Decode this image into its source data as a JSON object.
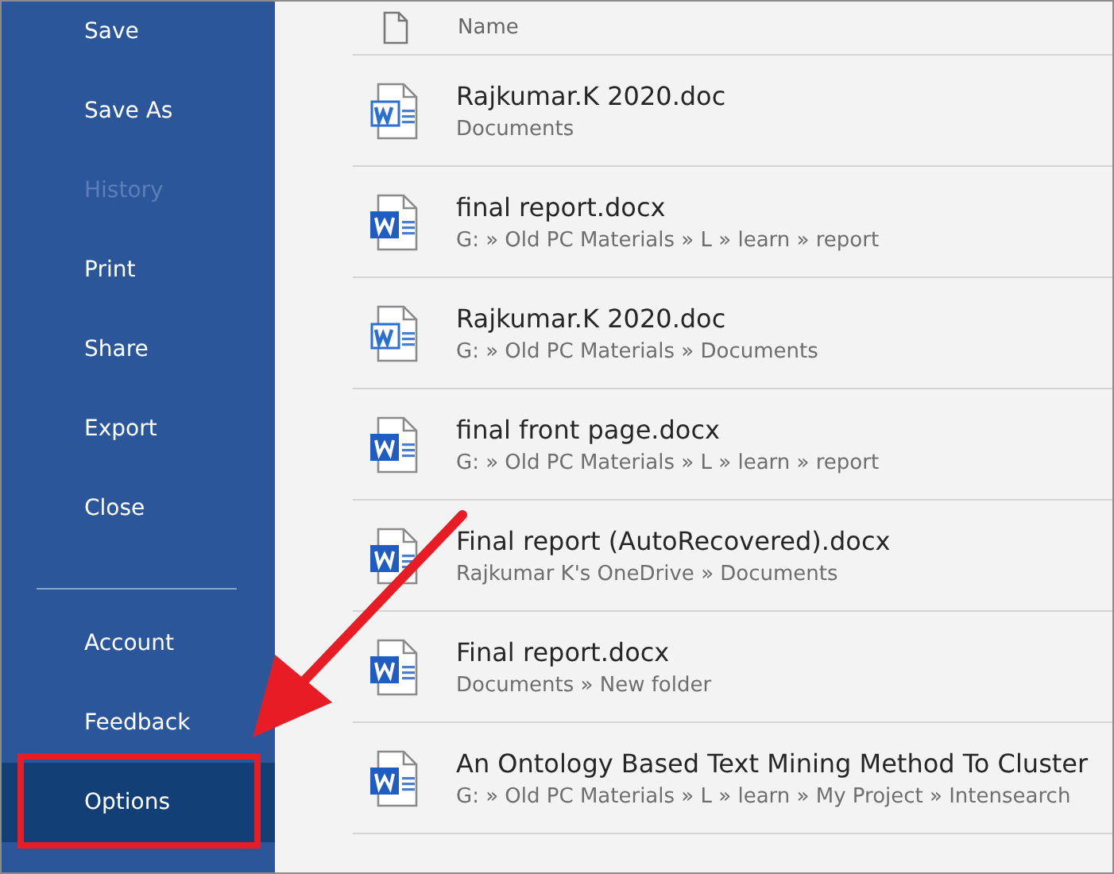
{
  "sidebar": {
    "items": [
      {
        "kind": "command",
        "label": "Save",
        "disabled": false,
        "selected": false
      },
      {
        "kind": "command",
        "label": "Save As",
        "disabled": false,
        "selected": false
      },
      {
        "kind": "command",
        "label": "History",
        "disabled": true,
        "selected": false
      },
      {
        "kind": "command",
        "label": "Print",
        "disabled": false,
        "selected": false
      },
      {
        "kind": "command",
        "label": "Share",
        "disabled": false,
        "selected": false
      },
      {
        "kind": "command",
        "label": "Export",
        "disabled": false,
        "selected": false
      },
      {
        "kind": "command",
        "label": "Close",
        "disabled": false,
        "selected": false
      },
      {
        "kind": "divider"
      },
      {
        "kind": "command",
        "label": "Account",
        "disabled": false,
        "selected": false
      },
      {
        "kind": "command",
        "label": "Feedback",
        "disabled": false,
        "selected": false
      },
      {
        "kind": "command",
        "label": "Options",
        "disabled": false,
        "selected": true
      }
    ]
  },
  "file_list": {
    "column": "Name",
    "rows": [
      {
        "kind": "doc",
        "name": "Rajkumar.K 2020.doc",
        "location": "Documents"
      },
      {
        "kind": "docx",
        "name": "final report.docx",
        "location": "G: » Old PC Materials » L » learn » report"
      },
      {
        "kind": "doc",
        "name": "Rajkumar.K 2020.doc",
        "location": "G: » Old PC Materials » Documents"
      },
      {
        "kind": "docx",
        "name": "final front page.docx",
        "location": "G: » Old PC Materials » L » learn » report"
      },
      {
        "kind": "docx",
        "name": "Final report (AutoRecovered).docx",
        "location": "Rajkumar K's OneDrive » Documents"
      },
      {
        "kind": "docx",
        "name": "Final report.docx",
        "location": "Documents » New folder"
      },
      {
        "kind": "docx",
        "name": "An Ontology Based Text Mining Method To Cluster",
        "location": "G: » Old PC Materials » L » learn » My Project » Intensearch"
      }
    ]
  }
}
